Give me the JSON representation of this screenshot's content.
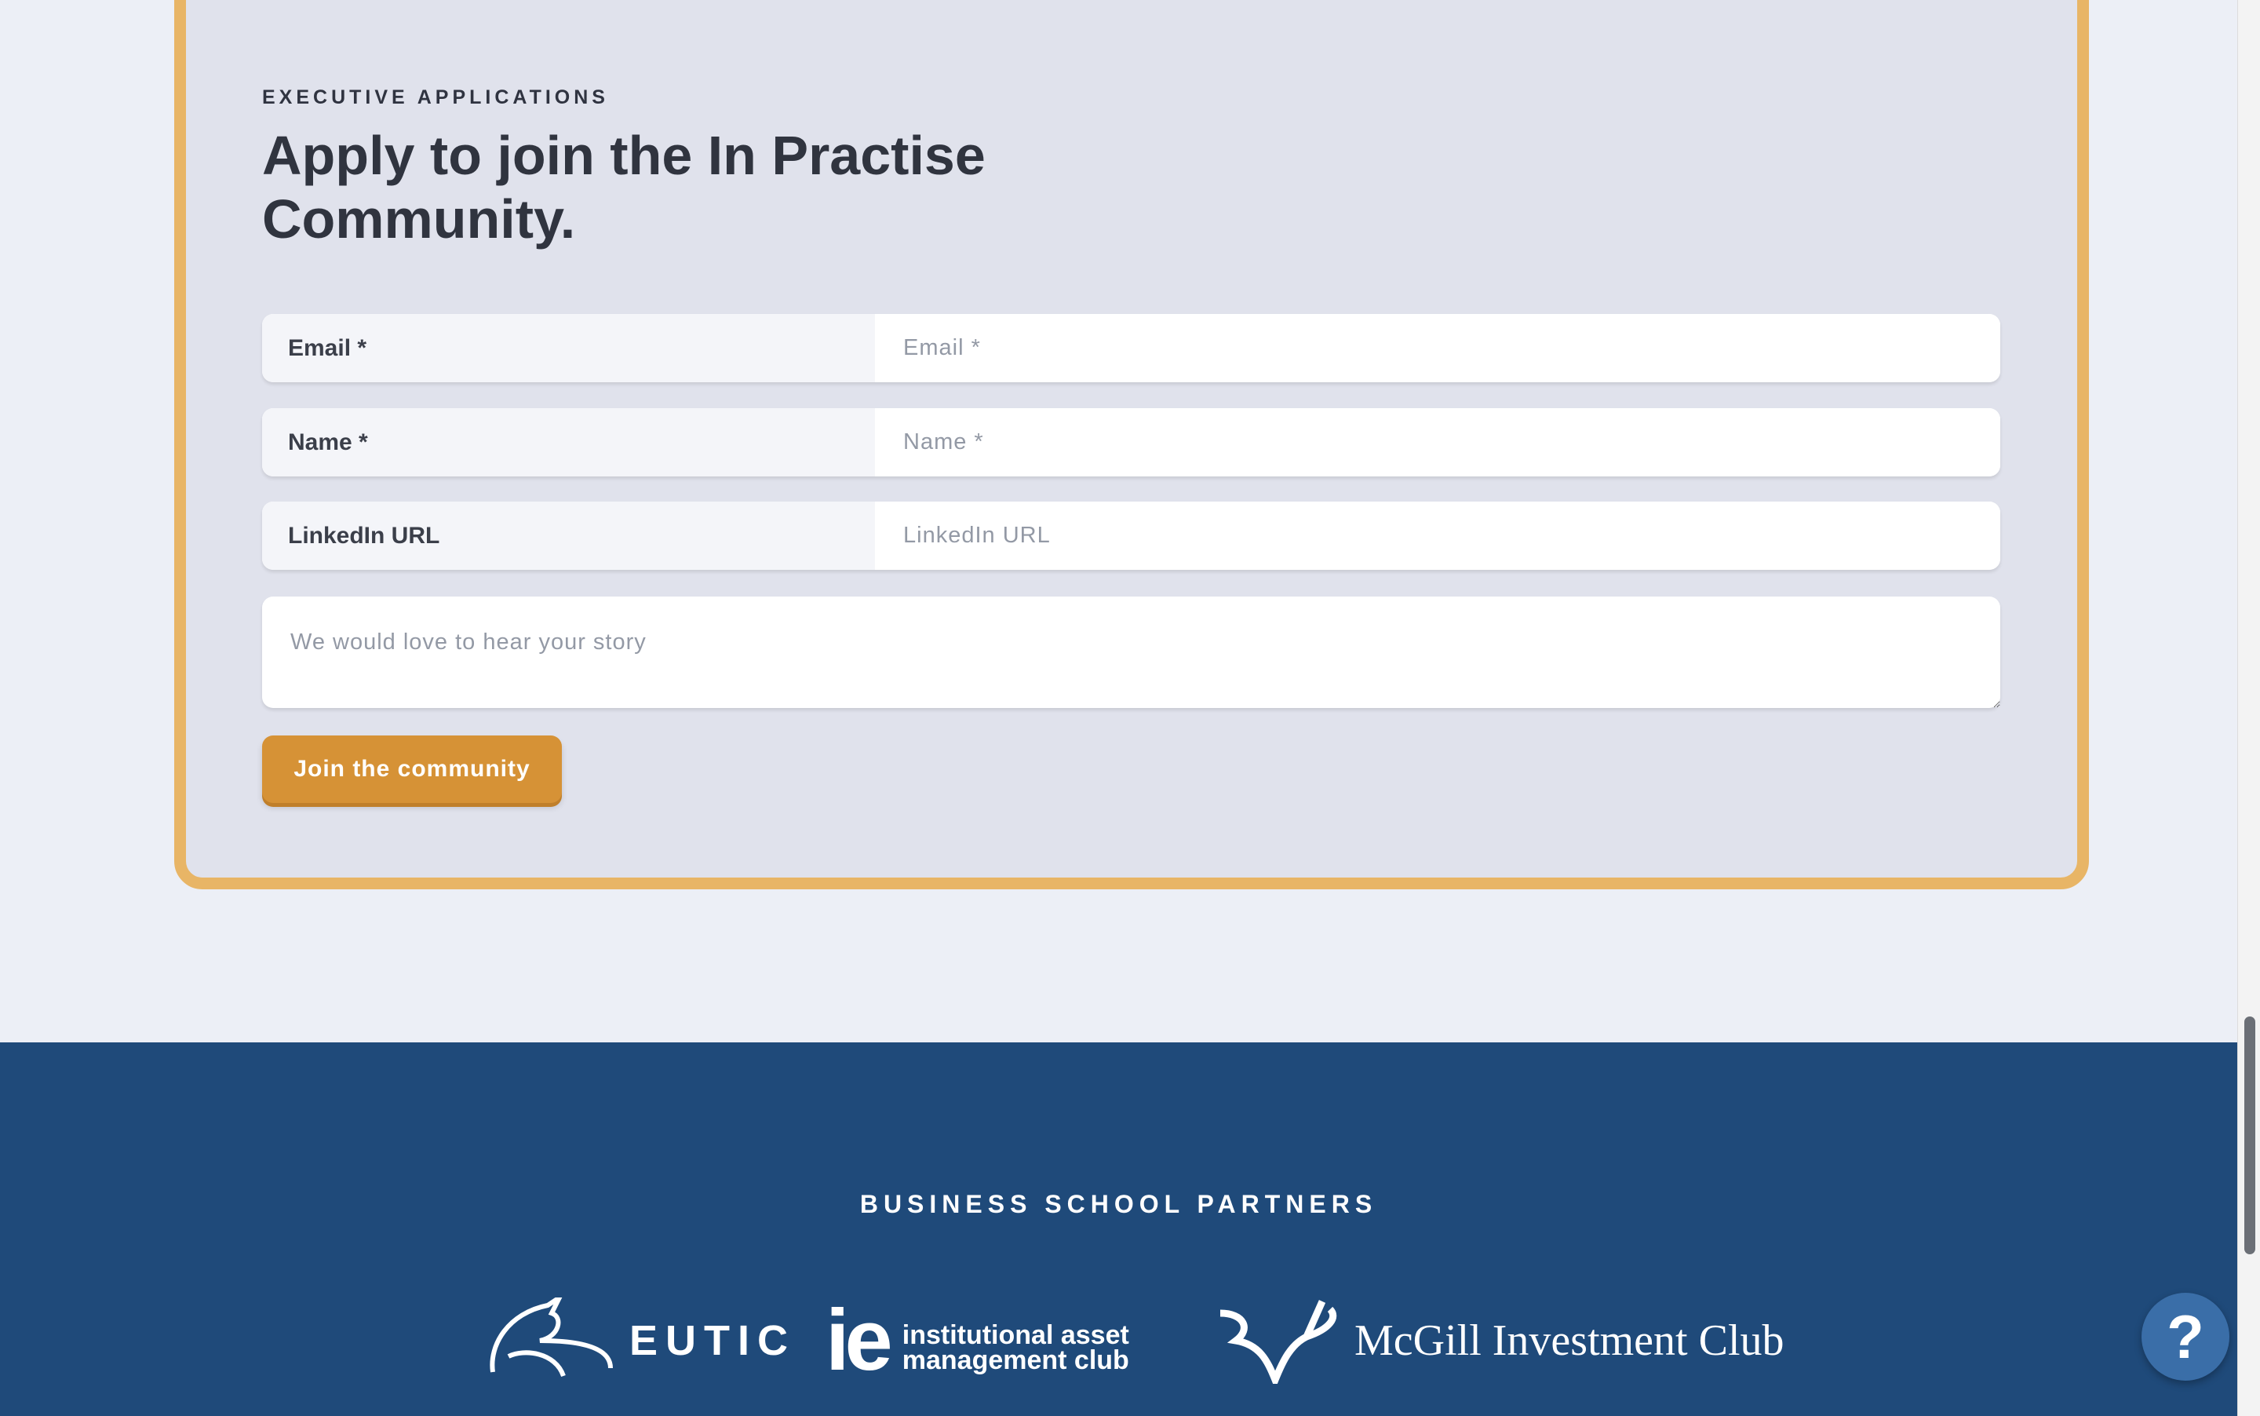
{
  "form": {
    "eyebrow": "EXECUTIVE APPLICATIONS",
    "title": "Apply to join the In Practise Community.",
    "fields": [
      {
        "label": "Email *",
        "placeholder": "Email *"
      },
      {
        "label": "Name *",
        "placeholder": "Name *"
      },
      {
        "label": "LinkedIn URL",
        "placeholder": "LinkedIn URL"
      }
    ],
    "story_placeholder": "We would love to hear your story",
    "submit_label": "Join the community"
  },
  "footer": {
    "title": "BUSINESS SCHOOL PARTNERS",
    "partners": [
      {
        "name": "EUTIC"
      },
      {
        "mark": "ie",
        "line1": "institutional asset",
        "line2": "management club"
      },
      {
        "name": "McGill Investment Club"
      }
    ]
  },
  "help": {
    "label": "?"
  },
  "colors": {
    "accent": "#d69236",
    "border": "#e8b566",
    "footer": "#1f4a7a"
  }
}
